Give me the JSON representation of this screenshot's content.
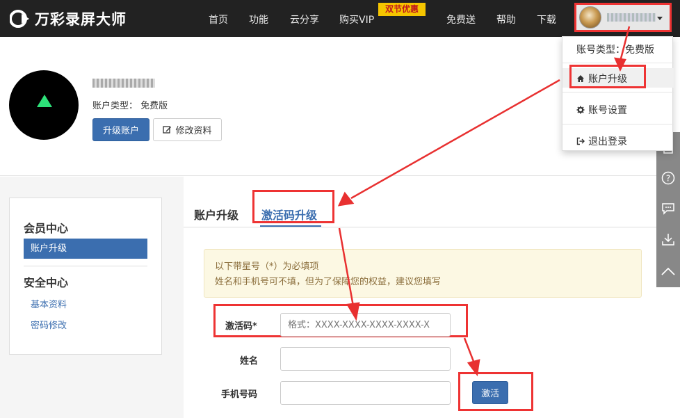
{
  "brand": {
    "name": "万彩录屏大师"
  },
  "nav": {
    "items": [
      "首页",
      "功能",
      "云分享",
      "购买VIP",
      "免费送",
      "帮助",
      "下载"
    ],
    "vip_badge": "双节优惠"
  },
  "user_menu": {
    "account_type": "账号类型：免费版",
    "items": [
      "账户升级",
      "账号设置",
      "退出登录"
    ]
  },
  "profile": {
    "account_type": "账户类型：  免费版",
    "upgrade_button": "升级账户",
    "edit_button": "修改资料"
  },
  "sidebar": {
    "section1": "会员中心",
    "active_item": "账户升级",
    "section2": "安全中心",
    "links": [
      "基本资料",
      "密码修改"
    ]
  },
  "tabs": [
    "账户升级",
    "激活码升级"
  ],
  "notice": {
    "line1": "以下带星号（*）为必填项",
    "line2": "姓名和手机号可不填，但为了保障您的权益，建议您填写"
  },
  "form": {
    "code_label": "激活码*",
    "code_placeholder": "格式：XXXX-XXXX-XXXX-XXXX-X",
    "name_label": "姓名",
    "phone_label": "手机号码",
    "submit": "激活"
  },
  "colors": {
    "nav_bg": "#222222",
    "primary": "#3b6eaf",
    "highlight": "#e33333",
    "notice_bg": "#fcf8e3",
    "badge": "#f5c500"
  }
}
